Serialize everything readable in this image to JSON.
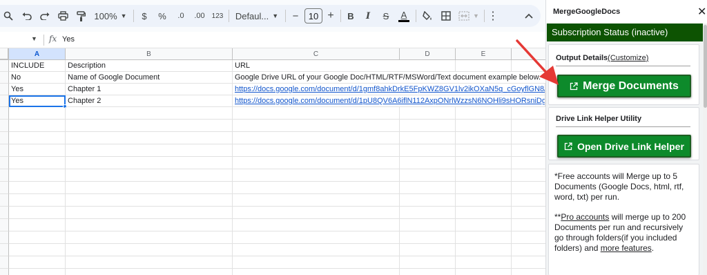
{
  "toolbar": {
    "zoom": "100%",
    "currency": "$",
    "percent": "%",
    "decrease_decimal": ".0",
    "increase_decimal": ".00",
    "number_format": "123",
    "font_family": "Defaul...",
    "font_size": "10",
    "minus": "−",
    "plus": "+",
    "bold": "B",
    "italic": "I",
    "strikethrough": "S",
    "text_color": "A",
    "text_color_value": "#000000",
    "more": "⋮",
    "collapse": "^"
  },
  "formula_bar": {
    "fx": "fx",
    "value": "Yes"
  },
  "grid": {
    "columns": [
      "A",
      "B",
      "C",
      "D",
      "E"
    ],
    "selected_column": "A",
    "rows": [
      {
        "a": "INCLUDE",
        "b": "Description",
        "c": "URL",
        "dropdown": false,
        "link": false
      },
      {
        "a": "No",
        "b": "Name of Google Document",
        "c": "Google Drive URL of your Google Doc/HTML/RTF/MSWord/Text document example below.",
        "dropdown": true,
        "link": false
      },
      {
        "a": "Yes",
        "b": "Chapter 1",
        "c": "https://docs.google.com/document/d/1gmf8ahkDrkE5FpKWZ8GV1lv2ikOXaN5q_cGoyflGN8/",
        "dropdown": true,
        "link": true
      },
      {
        "a": "Yes",
        "b": "Chapter 2",
        "c": "https://docs.google.com/document/d/1pU8QV6A6iflN112AxpONrlWzzsN6NOHli9sHORsniDg",
        "dropdown": true,
        "link": true
      }
    ],
    "empty_dropdown_rows": 14
  },
  "sidebar": {
    "title": "MergeGoogleDocs",
    "close": "✕",
    "status": "Subscription Status (inactive)",
    "status_color": "#0d5302",
    "output_title": "Output Details",
    "output_link": "(Customize)",
    "merge_button": "Merge Documents",
    "button_color": "#0d8a2b",
    "helper_title": "Drive Link Helper Utility",
    "helper_button": "Open Drive Link Helper",
    "info": {
      "p1": "*Free accounts will Merge up to 5 Documents (Google Docs, html, rtf, word, txt) per run.",
      "p2_prefix": "**",
      "p2_link": "Pro accounts",
      "p2_mid": " will merge up to 200 Documents per run and recursively go through folders(if you included folders) and ",
      "p2_link2": "more features",
      "p2_end": "."
    }
  },
  "annotation_color": "#e53935"
}
